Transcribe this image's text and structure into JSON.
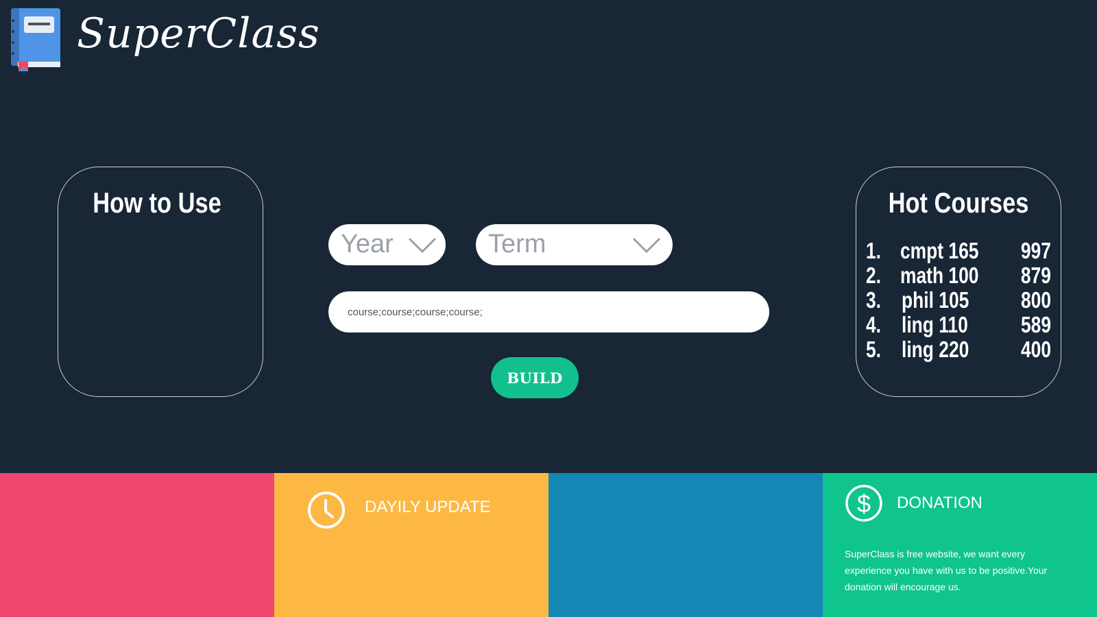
{
  "header": {
    "title": "SuperClass",
    "logo_icon": "book-icon"
  },
  "how_to_use": {
    "title": "How to Use"
  },
  "form": {
    "year_placeholder": "Year",
    "term_placeholder": "Term",
    "courses_value": "course;course;course;course;",
    "build_label": "BUILD"
  },
  "hot_courses": {
    "title": "Hot Courses",
    "items": [
      {
        "rank": "1.",
        "course": "cmpt 165",
        "count": "997"
      },
      {
        "rank": "2.",
        "course": "math 100",
        "count": "879"
      },
      {
        "rank": "3.",
        "course": "phil 105",
        "count": "800"
      },
      {
        "rank": "4.",
        "course": "ling 110",
        "count": "589"
      },
      {
        "rank": "5.",
        "course": "ling 220",
        "count": "400"
      }
    ]
  },
  "footer": {
    "daily_update": {
      "heading": "DAYILY UPDATE",
      "icon": "clock-icon"
    },
    "donation": {
      "heading": "DONATION",
      "icon": "dollar-icon",
      "text": "SuperClass is free website, we want every experience you have with us to be positive.Your donation will encourage us."
    }
  },
  "colors": {
    "background": "#182636",
    "accent_green": "#10c48e",
    "tile_red": "#ef4670",
    "tile_yellow": "#fdb844",
    "tile_blue": "#1487b4"
  }
}
